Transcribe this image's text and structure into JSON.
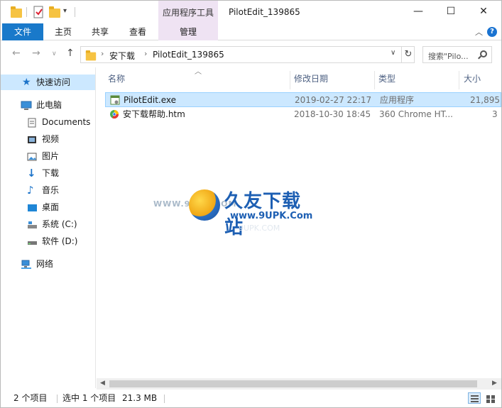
{
  "window": {
    "title": "PilotEdit_139865",
    "context_tab_title": "应用程序工具",
    "controls": {
      "minimize": "—",
      "maximize": "☐",
      "close": "✕"
    }
  },
  "ribbon": {
    "tabs": [
      {
        "label": "文件"
      },
      {
        "label": "主页"
      },
      {
        "label": "共享"
      },
      {
        "label": "查看"
      },
      {
        "label": "管理"
      }
    ],
    "help": "?"
  },
  "address": {
    "crumbs": [
      "安下载",
      "PilotEdit_139865"
    ],
    "search_placeholder": "搜索\"Pilo..."
  },
  "nav": {
    "items": [
      {
        "label": "快速访问",
        "icon": "star-icon"
      },
      {
        "label": "此电脑",
        "icon": "computer-icon"
      },
      {
        "label": "Documents",
        "icon": "documents-icon"
      },
      {
        "label": "视频",
        "icon": "video-icon"
      },
      {
        "label": "图片",
        "icon": "picture-icon"
      },
      {
        "label": "下载",
        "icon": "download-icon"
      },
      {
        "label": "音乐",
        "icon": "music-icon"
      },
      {
        "label": "桌面",
        "icon": "desktop-icon"
      },
      {
        "label": "系统 (C:)",
        "icon": "drive-c-icon"
      },
      {
        "label": "软件 (D:)",
        "icon": "drive-d-icon"
      },
      {
        "label": "网络",
        "icon": "network-icon"
      }
    ]
  },
  "columns": {
    "name": "名称",
    "date": "修改日期",
    "type": "类型",
    "size": "大小"
  },
  "files": [
    {
      "name": "PilotEdit.exe",
      "date": "2019-02-27 22:17",
      "type": "应用程序",
      "size": "21,895",
      "icon": "exe-icon"
    },
    {
      "name": "安下载帮助.htm",
      "date": "2018-10-30 18:45",
      "type": "360 Chrome HT...",
      "size": "3",
      "icon": "htm-icon"
    }
  ],
  "watermark": {
    "url": "WWW.9UPK.COM",
    "cn": "久友下载站",
    "en": "www.9UPK.Com",
    "faint": "9UPK.COM"
  },
  "status": {
    "item_count": "2 个项目",
    "selected": "选中 1 个项目",
    "size": "21.3 MB"
  },
  "colors": {
    "accent": "#1979ca",
    "selection": "#cce8ff",
    "context_tab": "#efe3f3"
  }
}
